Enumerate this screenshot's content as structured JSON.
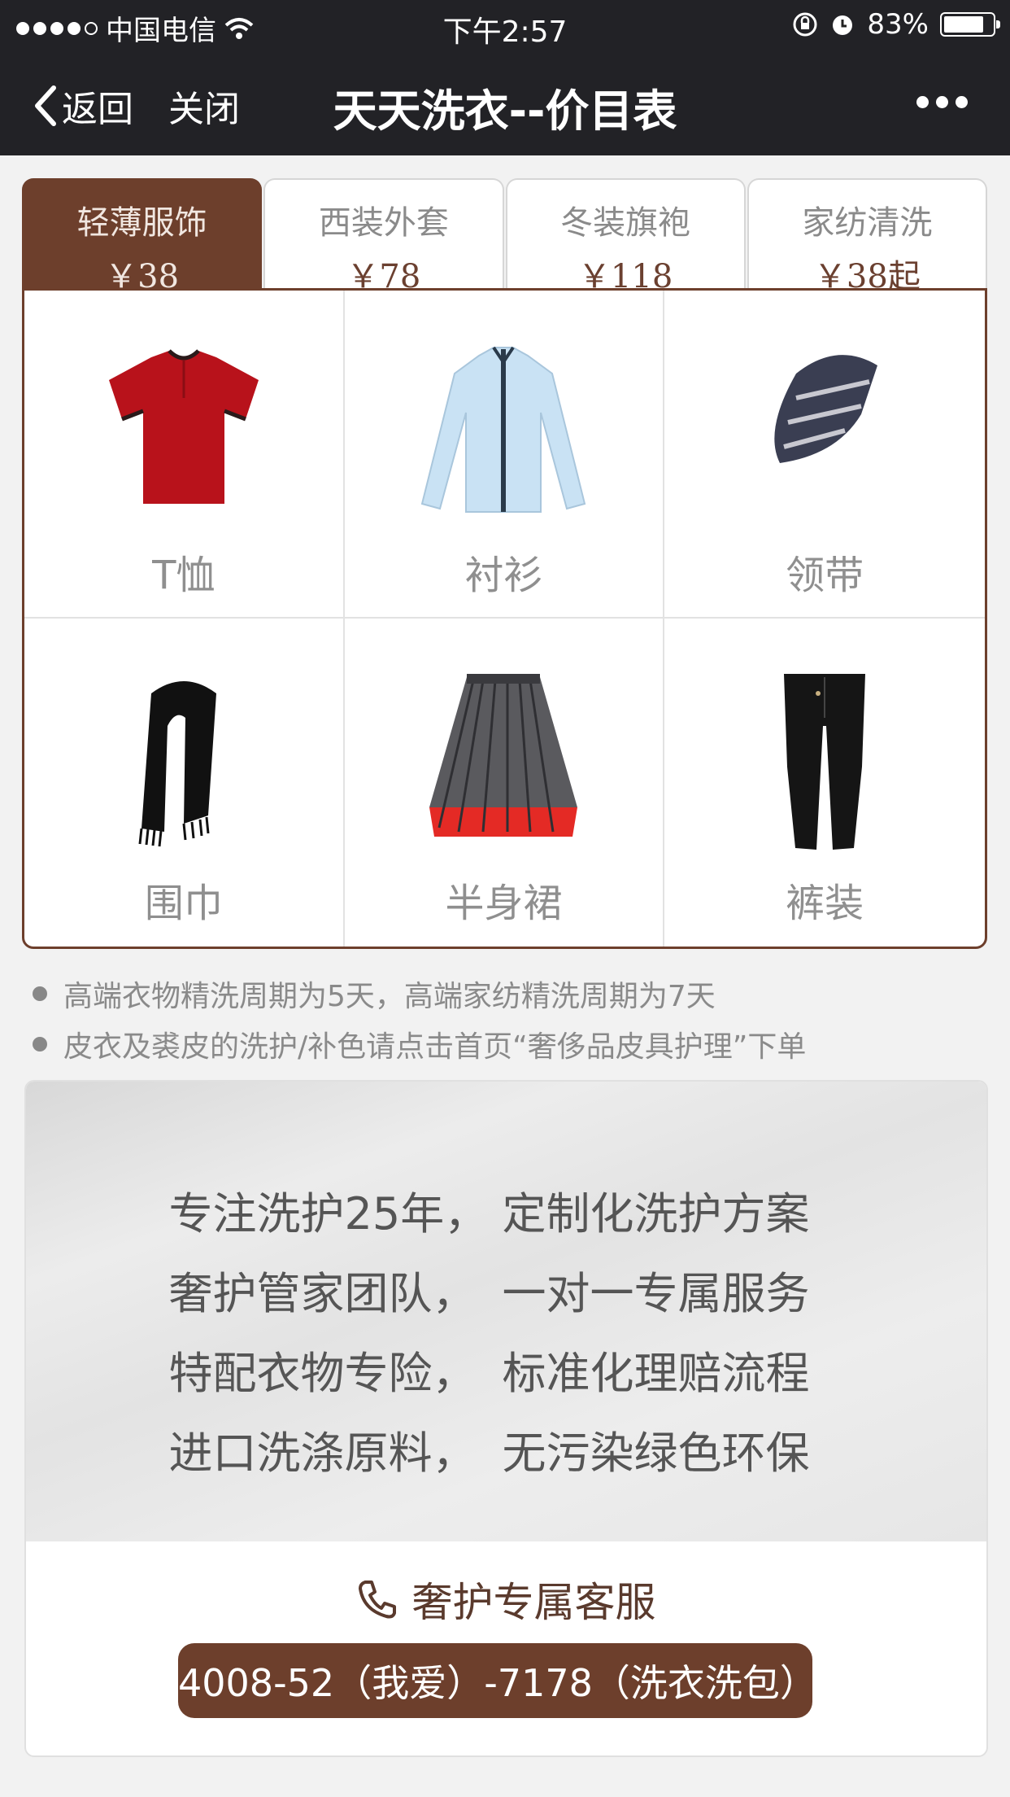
{
  "status_bar": {
    "carrier": "中国电信",
    "time": "下午2:57",
    "battery": "83%",
    "battery_level": 0.83
  },
  "nav": {
    "back_label": "返回",
    "close_label": "关闭",
    "title": "天天洗衣--价目表",
    "more_icon": "more-dots-icon"
  },
  "tabs": [
    {
      "name": "轻薄服饰",
      "price": "￥38",
      "active": true
    },
    {
      "name": "西装外套",
      "price": "￥78",
      "active": false
    },
    {
      "name": "冬装旗袍",
      "price": "￥118",
      "active": false
    },
    {
      "name": "家纺清洗",
      "price": "￥38起",
      "active": false
    }
  ],
  "items": [
    {
      "label": "T恤",
      "icon": "tshirt-icon"
    },
    {
      "label": "衬衫",
      "icon": "shirt-icon"
    },
    {
      "label": "领带",
      "icon": "tie-icon"
    },
    {
      "label": "围巾",
      "icon": "scarf-icon"
    },
    {
      "label": "半身裙",
      "icon": "skirt-icon"
    },
    {
      "label": "裤装",
      "icon": "pants-icon"
    }
  ],
  "notes": [
    "高端衣物精洗周期为5天，高端家纺精洗周期为7天",
    "皮衣及裘皮的洗护/补色请点击首页“奢侈品皮具护理”下单"
  ],
  "promo": {
    "lines": [
      {
        "a": "专注洗护25年，",
        "b": "定制化洗护方案"
      },
      {
        "a": "奢护管家团队，",
        "b": "一对一专属服务"
      },
      {
        "a": "特配衣物专险，",
        "b": "标准化理赔流程"
      },
      {
        "a": "进口洗涤原料，",
        "b": "无污染绿色环保"
      }
    ],
    "service_label": "奢护专属客服",
    "phone": "4008-52（我爱）-7178（洗衣洗包）"
  },
  "colors": {
    "accent": "#6d3f2c",
    "nav_bg": "#222226"
  }
}
